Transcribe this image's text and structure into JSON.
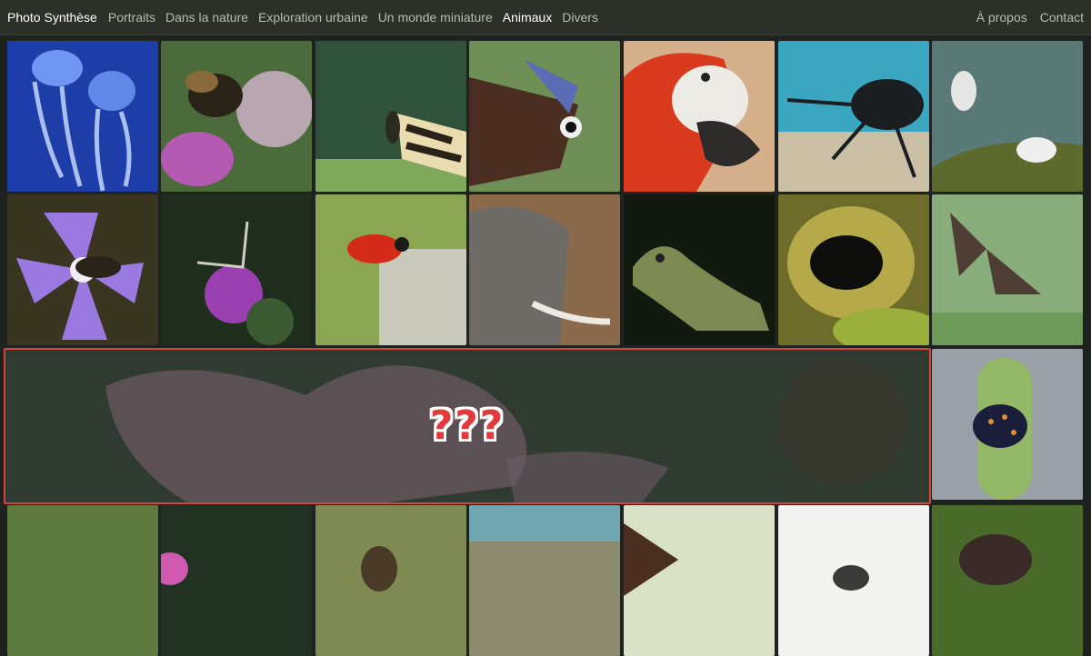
{
  "nav": {
    "brand": "Photo Synthèse",
    "links": [
      "Portraits",
      "Dans la nature",
      "Exploration urbaine",
      "Un monde miniature",
      "Animaux",
      "Divers"
    ],
    "active": "Animaux",
    "right_links": [
      "À propos",
      "Contact"
    ]
  },
  "mystery": {
    "text": "???"
  }
}
